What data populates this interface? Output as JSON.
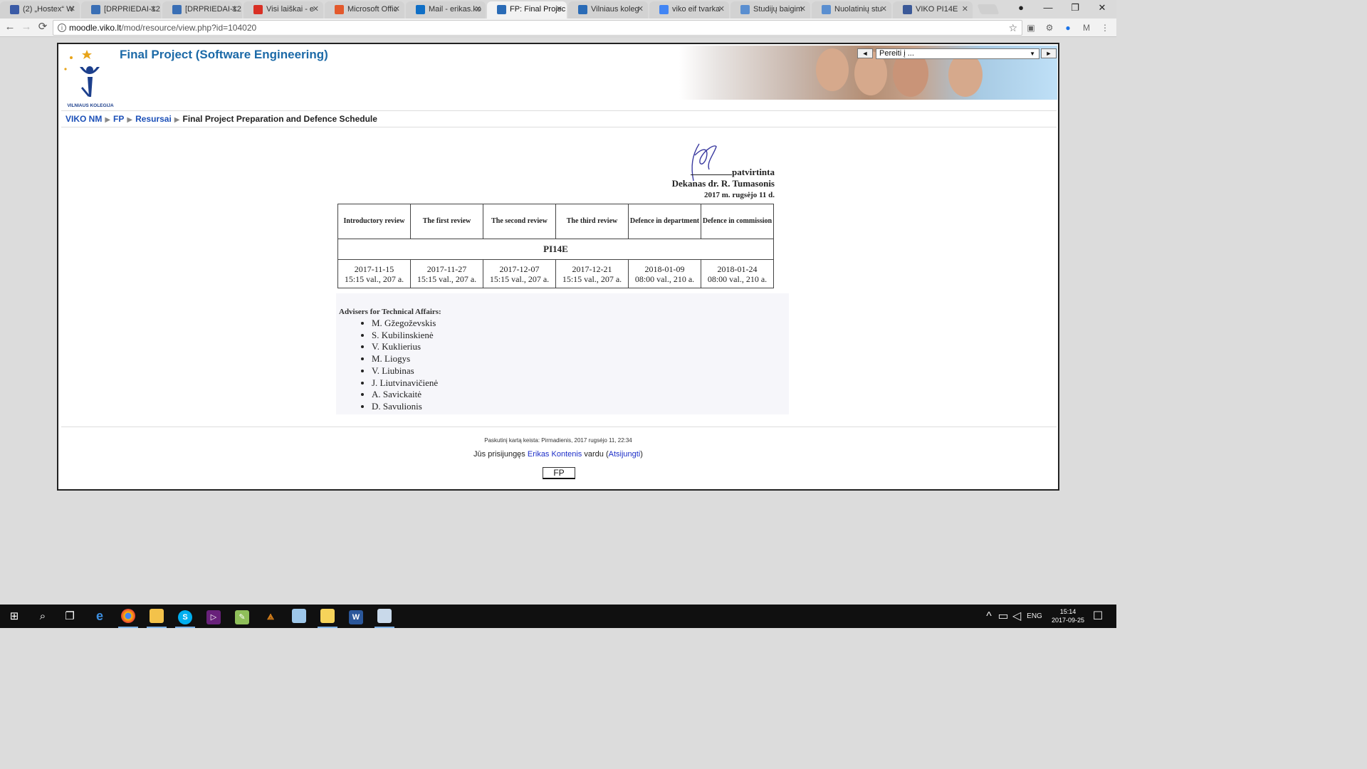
{
  "browser": {
    "tabs": [
      {
        "title": "(2) „Hostex“ W",
        "icon": "hostex-icon",
        "color": "#3b5ba6"
      },
      {
        "title": "[DRPRIEDAI-12",
        "icon": "bug-icon",
        "color": "#3a6fb5"
      },
      {
        "title": "[DRPRIEDAI-12",
        "icon": "bug-icon",
        "color": "#3a6fb5"
      },
      {
        "title": "Visi laiškai - e",
        "icon": "gmail-icon",
        "color": "#d93025"
      },
      {
        "title": "Microsoft Offic",
        "icon": "office-icon",
        "color": "#e3592c"
      },
      {
        "title": "Mail - erikas.ko",
        "icon": "outlook-icon",
        "color": "#0f6fc6"
      },
      {
        "title": "FP: Final Projec",
        "icon": "moodle-icon",
        "color": "#2a6bb6"
      },
      {
        "title": "Vilniaus koleg",
        "icon": "moodle-icon",
        "color": "#2a6bb6"
      },
      {
        "title": "viko eif tvarka",
        "icon": "google-icon",
        "color": "#4285f4"
      },
      {
        "title": "Studijų baigim",
        "icon": "viko-icon",
        "color": "#5b8fd0"
      },
      {
        "title": "Nuolatinių stu",
        "icon": "viko-icon",
        "color": "#5b8fd0"
      },
      {
        "title": "VIKO PI14E",
        "icon": "facebook-icon",
        "color": "#3b5998"
      }
    ],
    "active_tab": 6,
    "url_host": "moodle.viko.lt",
    "url_path": "/mod/resource/view.php?id=104020"
  },
  "site": {
    "title": "Final Project (Software Engineering)",
    "logo_text": "VILNIAUS KOLEGIJA",
    "jump_placeholder": "Pereiti į ...",
    "jump_prev": "◄",
    "jump_next": "►"
  },
  "breadcrumb": {
    "items": [
      "VIKO NM",
      "FP",
      "Resursai"
    ],
    "current": "Final Project Preparation and Defence Schedule"
  },
  "document": {
    "approval": {
      "line1": "patvirtinta",
      "line2": "Dekanas dr. R. Tumasonis",
      "line3": "2017 m. rugsėjo 11 d."
    },
    "columns": [
      "Introductory review",
      "The first review",
      "The second review",
      "The third review",
      "Defence in department",
      "Defence in commission"
    ],
    "group": "PI14E",
    "dates": [
      "2017-11-15",
      "2017-11-27",
      "2017-12-07",
      "2017-12-21",
      "2018-01-09",
      "2018-01-24"
    ],
    "times": [
      "15:15 val., 207 a.",
      "15:15 val., 207 a.",
      "15:15 val., 207 a.",
      "15:15 val., 207 a.",
      "08:00 val., 210 a.",
      "08:00 val., 210 a."
    ],
    "advisers_title": "Advisers for Technical Affairs:",
    "advisers": [
      "M. Gžegoževskis",
      "S. Kubilinskienė",
      "V. Kuklierius",
      "M. Liogys",
      "V. Liubinas",
      "J. Liutvinavičienė",
      "A. Savickaitė",
      "D. Savulionis"
    ]
  },
  "footer": {
    "modified": "Paskutinį kartą keista: Pirmadienis, 2017 rugsėjo 11, 22:34",
    "login_prefix": "Jūs prisijungęs",
    "user": "Erikas Kontenis",
    "login_mid": "vardu",
    "logout": "Atsijungti",
    "course_button": "FP"
  },
  "taskbar": {
    "language": "ENG",
    "time": "15:14",
    "date": "2017-09-25"
  }
}
